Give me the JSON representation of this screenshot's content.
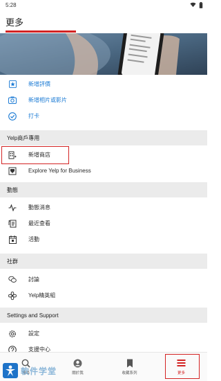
{
  "status_bar": {
    "time": "5:28",
    "wifi_icon": "wifi-icon",
    "battery_icon": "battery-icon"
  },
  "header": {
    "title": "更多",
    "accent_color": "#d32323"
  },
  "top_actions": [
    {
      "label": "新增評價",
      "icon": "star-icon"
    },
    {
      "label": "新增相片或影片",
      "icon": "camera-icon"
    },
    {
      "label": "打卡",
      "icon": "checkin-icon"
    }
  ],
  "business": {
    "header": "Yelp商戶專用",
    "items": [
      {
        "label": "新增商店",
        "icon": "add-business-icon"
      },
      {
        "label": "Explore Yelp for Business",
        "icon": "yelp-business-icon"
      }
    ]
  },
  "activity": {
    "header": "動態",
    "items": [
      {
        "label": "動態消息",
        "icon": "activity-feed-icon"
      },
      {
        "label": "最近查看",
        "icon": "recently-viewed-icon"
      },
      {
        "label": "活動",
        "icon": "events-icon"
      }
    ]
  },
  "community": {
    "header": "社群",
    "items": [
      {
        "label": "討論",
        "icon": "discussion-icon"
      },
      {
        "label": "Yelp精英組",
        "icon": "elite-icon"
      }
    ]
  },
  "settings": {
    "header": "Settings and Support",
    "items": [
      {
        "label": "設定",
        "icon": "gear-icon"
      },
      {
        "label": "支援中心",
        "icon": "support-icon"
      }
    ]
  },
  "bottom_nav": [
    {
      "label": "搜尋",
      "icon": "search-icon",
      "active": false
    },
    {
      "label": "關於我",
      "icon": "profile-icon",
      "active": false
    },
    {
      "label": "收藏系列",
      "icon": "bookmark-icon",
      "active": false
    },
    {
      "label": "更多",
      "icon": "menu-icon",
      "active": true
    }
  ],
  "watermark": {
    "text": "軟件学堂"
  },
  "colors": {
    "accent": "#d32323",
    "link_blue": "#1a7ad4",
    "section_bg": "#ebebeb"
  }
}
